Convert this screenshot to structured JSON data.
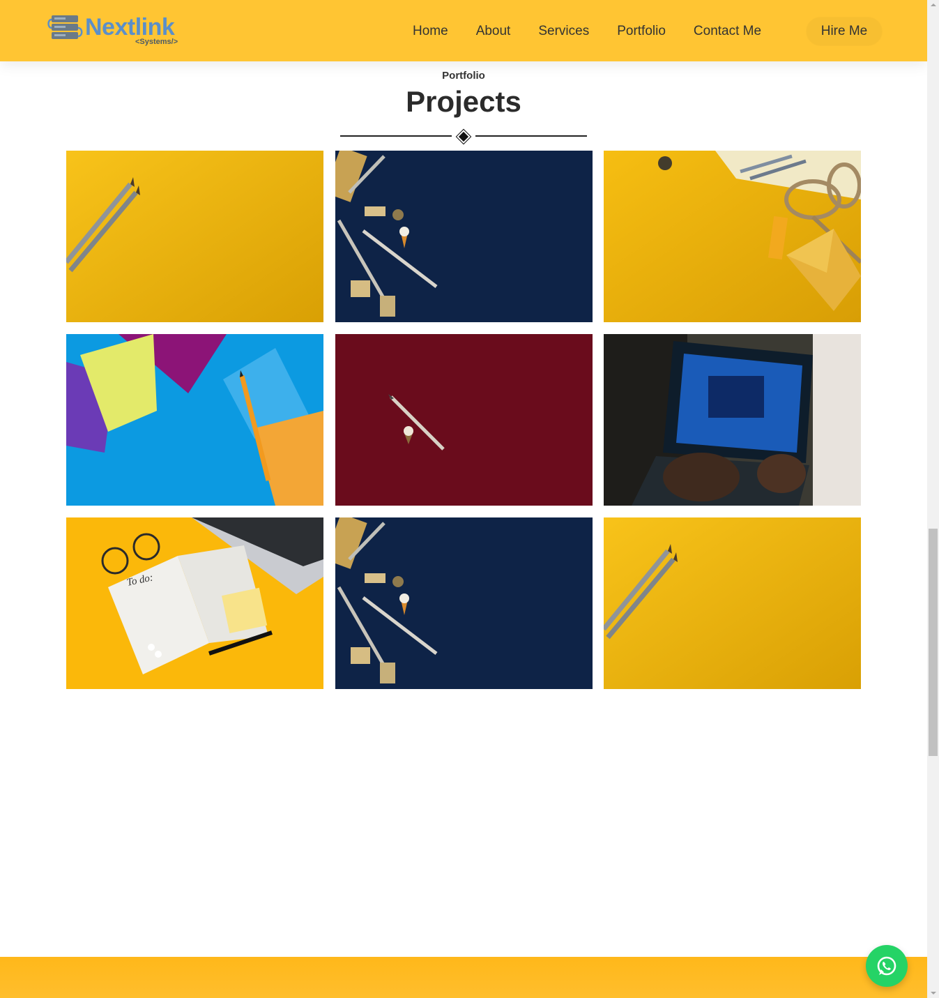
{
  "header": {
    "logo_text": "Nextlink",
    "logo_sub": "<Systems/>",
    "nav": [
      "Home",
      "About",
      "Services",
      "Portfolio",
      "Contact Me"
    ],
    "cta": "Hire Me"
  },
  "portfolio": {
    "eyebrow": "Portfolio",
    "title": "Projects",
    "projects": [
      {
        "theme": "yellow-pencils",
        "color": "#f5bd0d"
      },
      {
        "theme": "navy-stationery",
        "color": "#0e2347"
      },
      {
        "theme": "yellow-scissors",
        "color": "#f2b50a"
      },
      {
        "theme": "blue-envelopes",
        "color": "#119be0"
      },
      {
        "theme": "maroon-pencil",
        "color": "#6a0c1c"
      },
      {
        "theme": "laptop-typing",
        "color": "#1d2a36"
      },
      {
        "theme": "todo-notebook",
        "color": "#fbb80a",
        "text": "To do:"
      },
      {
        "theme": "navy-stationery",
        "color": "#0e2347"
      },
      {
        "theme": "yellow-pencils",
        "color": "#f5bd0d"
      }
    ]
  },
  "colors": {
    "header_bg": "#ffc533",
    "accent": "#ffb81a",
    "whatsapp": "#25d366"
  }
}
